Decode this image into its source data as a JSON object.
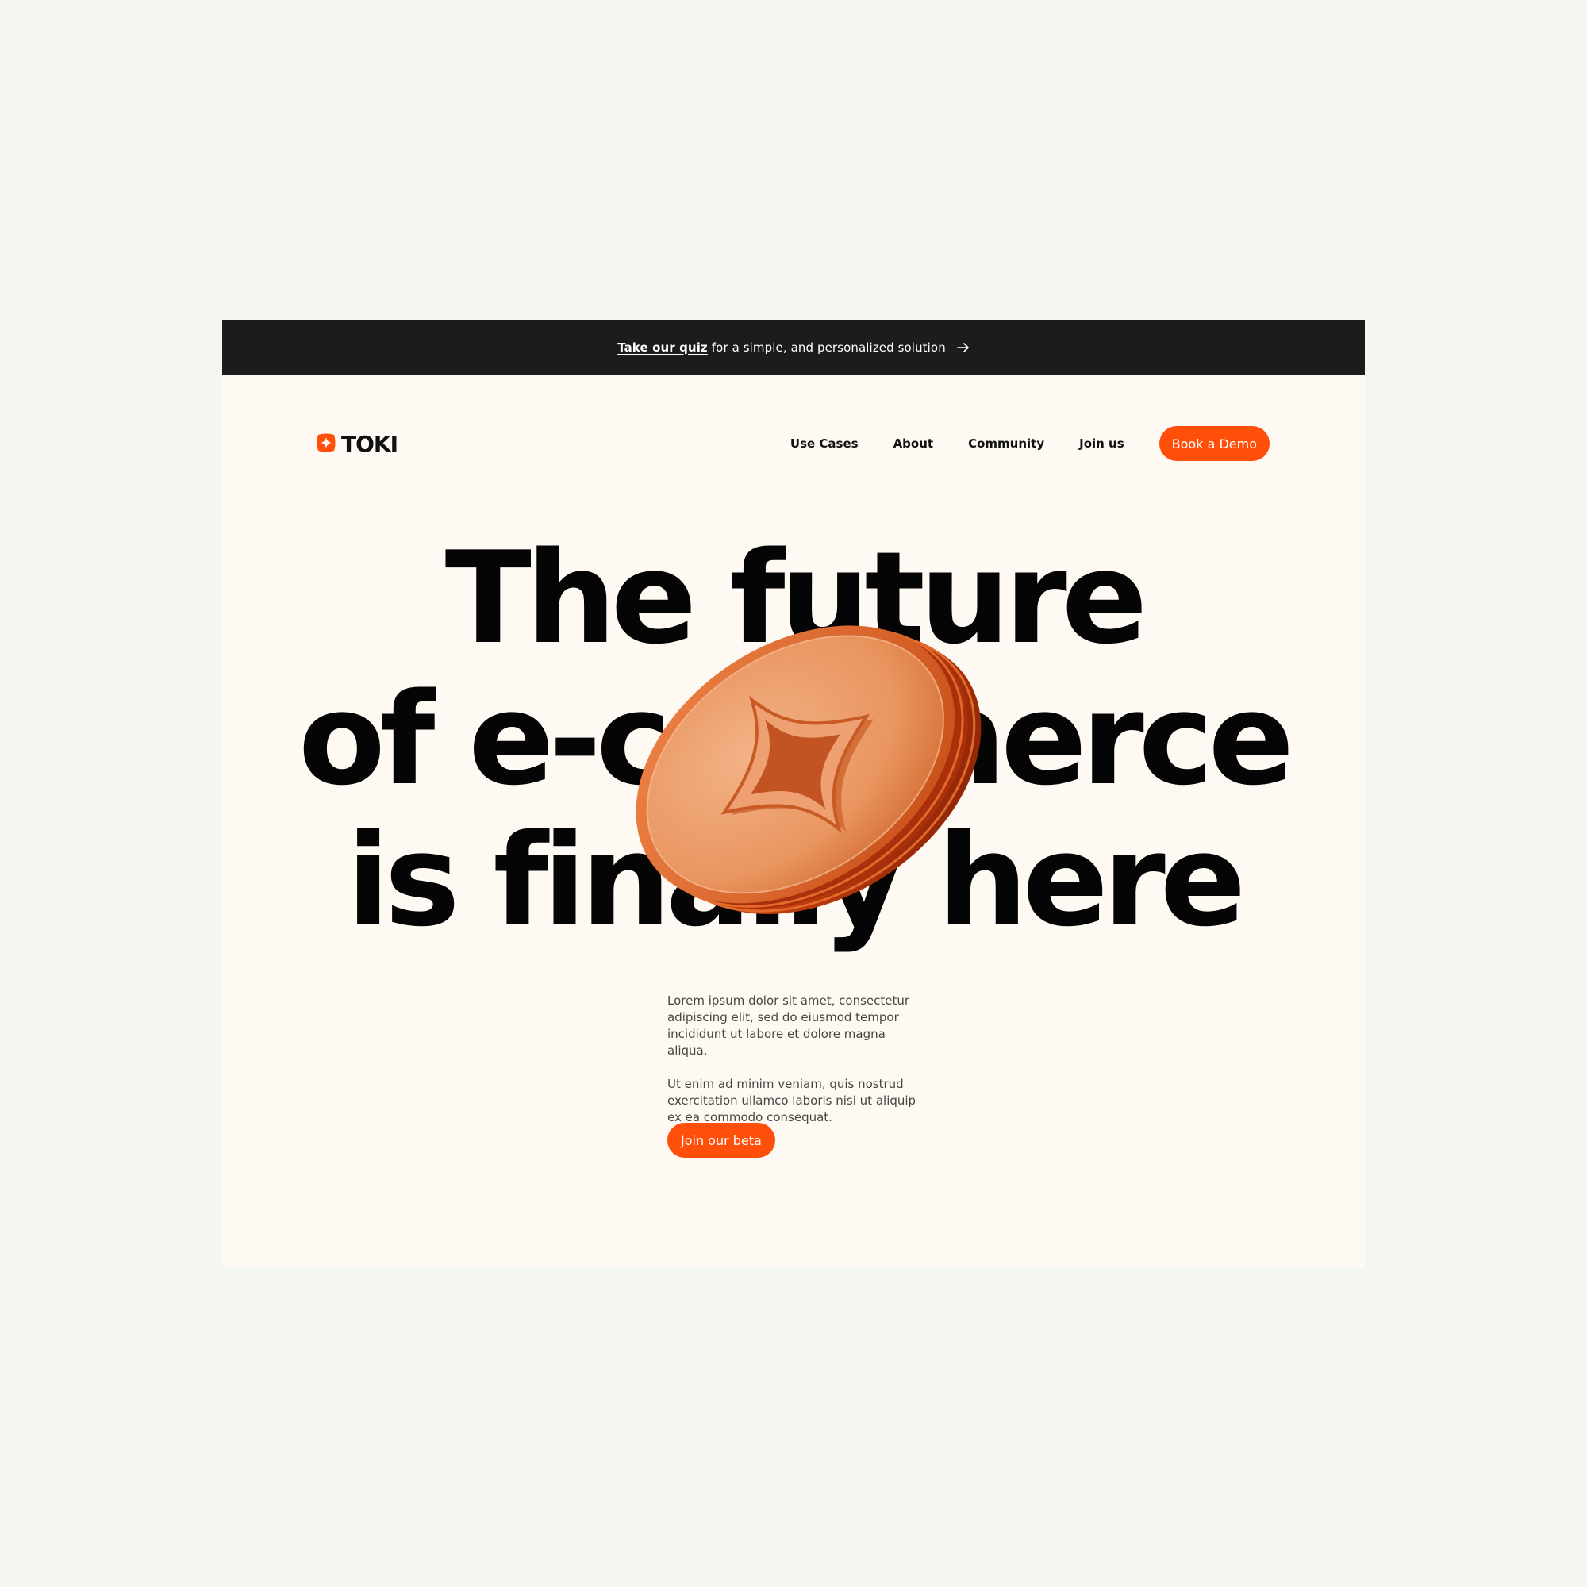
{
  "announcement": {
    "link_text": "Take our quiz",
    "text": "for a simple, and personalized solution",
    "icon": "arrow-right-icon"
  },
  "brand": {
    "name": "TOKI",
    "icon": "toki-star-logo-icon",
    "accent_color": "#ff4f0a"
  },
  "nav": {
    "links": [
      "Use Cases",
      "About",
      "Community",
      "Join us"
    ],
    "cta_label": "Book a Demo"
  },
  "hero": {
    "headline_lines": [
      "The future",
      "of e-commerce",
      "is finally here"
    ],
    "paragraphs": [
      "Lorem ipsum dolor sit amet, consectetur adipiscing elit, sed do eiusmod tempor incididunt ut labore et dolore magna aliqua.",
      "Ut enim ad minim veniam, quis nostrud exercitation ullamco laboris nisi ut aliquip ex ea commodo consequat."
    ],
    "cta_label": "Join our beta",
    "illustration": "orange-3d-coin-with-star-logo"
  },
  "colors": {
    "announcement_bg": "#1c1c1c",
    "page_bg": "#fef9f3",
    "outer_bg": "#f6f6f0"
  }
}
